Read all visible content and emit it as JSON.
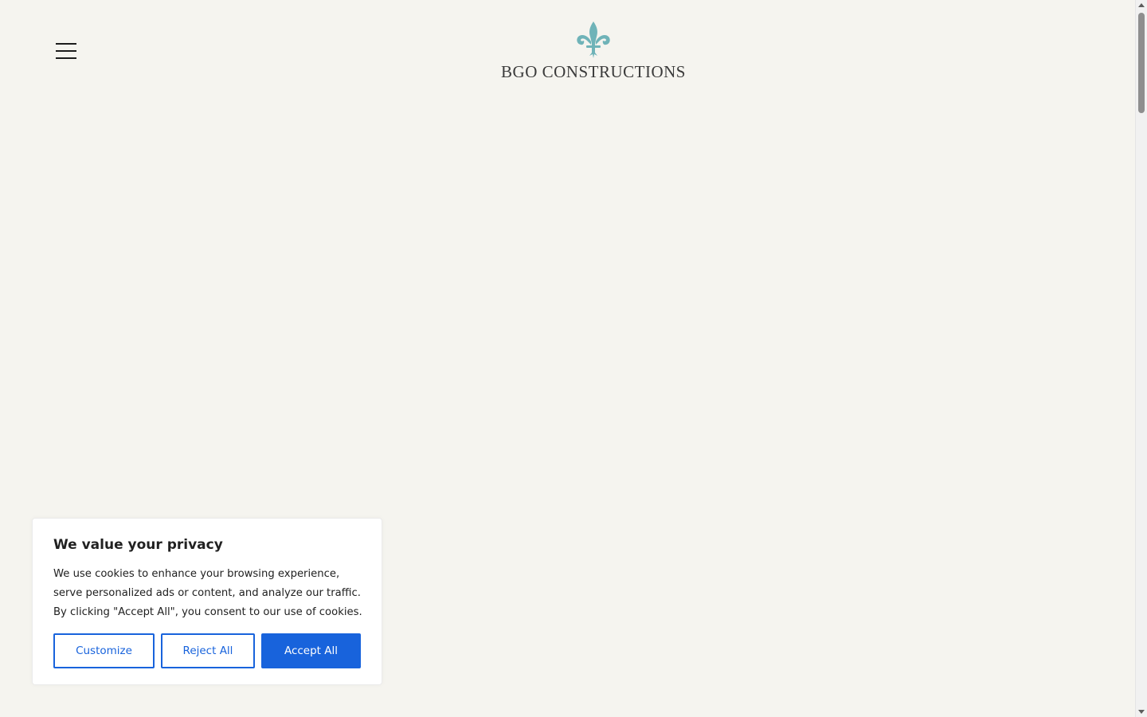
{
  "header": {
    "menu_icon": "hamburger-menu-icon",
    "logo_icon": "fleur-de-lis-icon",
    "logo_text": "BGO CONSTRUCTIONS"
  },
  "colors": {
    "background": "#f5f4ef",
    "brand_teal": "#6fb3b8",
    "primary_button": "#1863dc",
    "text_dark": "#212121"
  },
  "cookie_banner": {
    "title": "We value your privacy",
    "text": "We use cookies to enhance your browsing experience, serve personalized ads or content, and analyze our traffic. By clicking \"Accept All\", you consent to our use of cookies.",
    "customize_label": "Customize",
    "reject_label": "Reject All",
    "accept_label": "Accept All"
  }
}
